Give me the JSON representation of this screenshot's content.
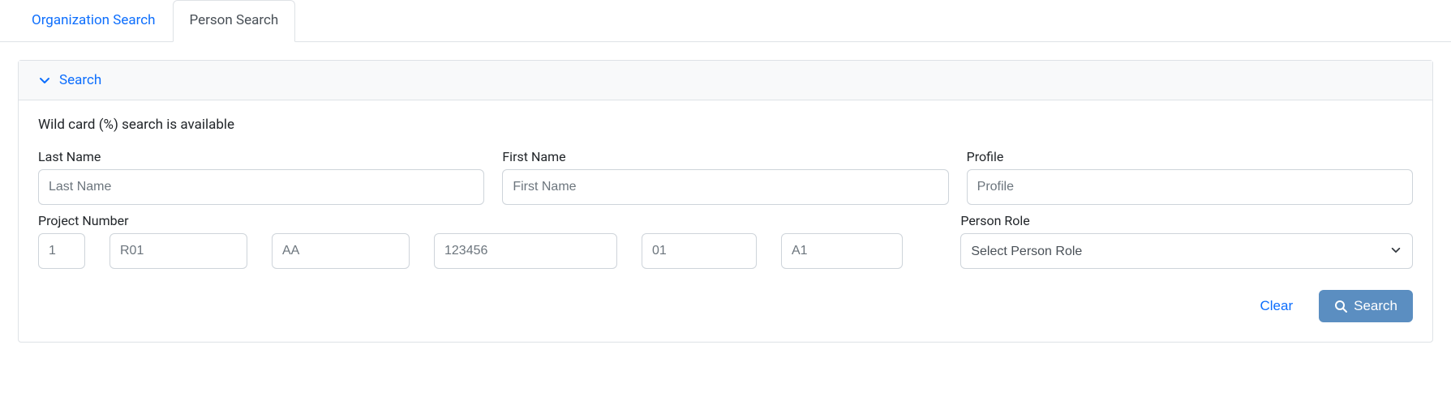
{
  "tabs": {
    "org": "Organization Search",
    "person": "Person Search"
  },
  "panel": {
    "title": "Search",
    "hint": "Wild card (%) search is available"
  },
  "fields": {
    "last_name": {
      "label": "Last Name",
      "placeholder": "Last Name",
      "value": ""
    },
    "first_name": {
      "label": "First Name",
      "placeholder": "First Name",
      "value": ""
    },
    "profile": {
      "label": "Profile",
      "placeholder": "Profile",
      "value": ""
    },
    "project_number": {
      "label": "Project Number",
      "parts": {
        "p1": {
          "placeholder": "1",
          "value": ""
        },
        "p2": {
          "placeholder": "R01",
          "value": ""
        },
        "p3": {
          "placeholder": "AA",
          "value": ""
        },
        "p4": {
          "placeholder": "123456",
          "value": ""
        },
        "p5": {
          "placeholder": "01",
          "value": ""
        },
        "p6": {
          "placeholder": "A1",
          "value": ""
        }
      }
    },
    "person_role": {
      "label": "Person Role",
      "selected": "Select Person Role"
    }
  },
  "actions": {
    "clear": "Clear",
    "search": "Search"
  }
}
